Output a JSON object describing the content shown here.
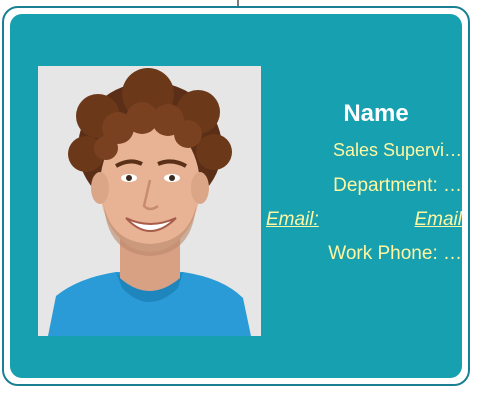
{
  "card": {
    "name": "Name",
    "job_title": "Sales Supervi…",
    "department": "Department:  …",
    "email_label": "Email:",
    "email_value": "Email",
    "work_phone": "Work Phone: …"
  },
  "colors": {
    "card_background": "#17a0b0",
    "card_border": "#1a7f93",
    "name_text": "#ffffff",
    "detail_text": "#fff7a1"
  }
}
